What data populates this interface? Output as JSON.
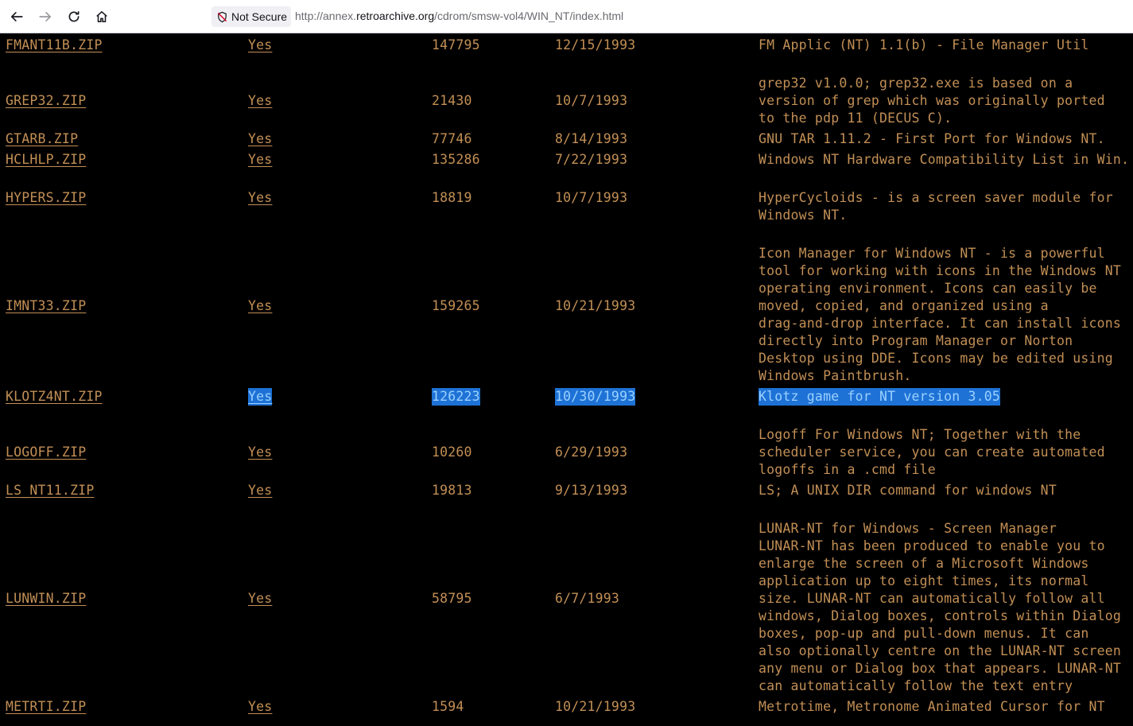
{
  "browser": {
    "security_label": "Not Secure",
    "url_prefix": "http://annex.",
    "url_domain": "retroarchive.org",
    "url_path": "/cdrom/smsw-vol4/WIN_NT/index.html"
  },
  "files": [
    {
      "name": "FMANT11B.ZIP",
      "avail": "Yes",
      "size": "147795",
      "date": "12/15/1993",
      "desc": [
        "FM Applic (NT) 1.1(b) - File Manager Util"
      ]
    },
    {
      "name": "GREP32.ZIP",
      "avail": "Yes",
      "size": "21430",
      "date": "10/7/1993",
      "desc": [
        "grep32 v1.0.0; grep32.exe is based on a",
        "version of grep which was originally ported",
        "to the pdp 11 (DECUS C)."
      ]
    },
    {
      "name": "GTARB.ZIP",
      "avail": "Yes",
      "size": "77746",
      "date": "8/14/1993",
      "desc": [
        "GNU TAR 1.11.2 - First Port for Windows NT."
      ]
    },
    {
      "name": "HCLHLP.ZIP",
      "avail": "Yes",
      "size": "135286",
      "date": "7/22/1993",
      "desc": [
        "Windows NT Hardware Compatibility List in Win."
      ]
    },
    {
      "name": "HYPERS.ZIP",
      "avail": "Yes",
      "size": "18819",
      "date": "10/7/1993",
      "desc": [
        "HyperCycloids - is a screen saver module for",
        "Windows NT."
      ]
    },
    {
      "name": "IMNT33.ZIP",
      "avail": "Yes",
      "size": "159265",
      "date": "10/21/1993",
      "desc": [
        "Icon Manager for Windows NT - is a powerful",
        "tool for working with icons in the Windows NT",
        "operating environment. Icons can easily be",
        "moved, copied, and organized using a",
        "drag-and-drop interface. It can install icons",
        "directly into Program Manager or Norton",
        "Desktop using DDE. Icons may be edited using",
        "Windows Paintbrush."
      ]
    },
    {
      "name": "KLOTZ4NT.ZIP",
      "avail": "Yes",
      "size": "126223",
      "date": "10/30/1993",
      "desc": [
        "Klotz game for NT version 3.05"
      ],
      "selected": true
    },
    {
      "name": "LOGOFF.ZIP",
      "avail": "Yes",
      "size": "10260",
      "date": "6/29/1993",
      "desc": [
        "Logoff For Windows NT; Together with the",
        "scheduler service, you can create automated",
        "logoffs in a .cmd file"
      ]
    },
    {
      "name": "LS_NT11.ZIP",
      "avail": "Yes",
      "size": "19813",
      "date": "9/13/1993",
      "desc": [
        "LS; A UNIX DIR command for windows NT"
      ]
    },
    {
      "name": "LUNWIN.ZIP",
      "avail": "Yes",
      "size": "58795",
      "date": "6/7/1993",
      "desc": [
        "LUNAR-NT for Windows - Screen Manager",
        "LUNAR-NT has been produced to enable you to",
        "enlarge the screen of a Microsoft Windows",
        "application up to eight times, its normal",
        "size. LUNAR-NT can automatically follow all",
        "windows, Dialog boxes, controls within Dialog",
        "boxes, pop-up and pull-down menus. It can",
        "also optionally centre on the LUNAR-NT screen",
        "any menu or Dialog box that appears. LUNAR-NT",
        "can automatically follow the text entry"
      ]
    },
    {
      "name": "METRTI.ZIP",
      "avail": "Yes",
      "size": "1594",
      "date": "10/21/1993",
      "desc": [
        "Metrotime, Metronome Animated Cursor for NT"
      ]
    }
  ],
  "colors": {
    "text": "#c28f55",
    "background": "#000000",
    "selection": "#1e72d6"
  }
}
